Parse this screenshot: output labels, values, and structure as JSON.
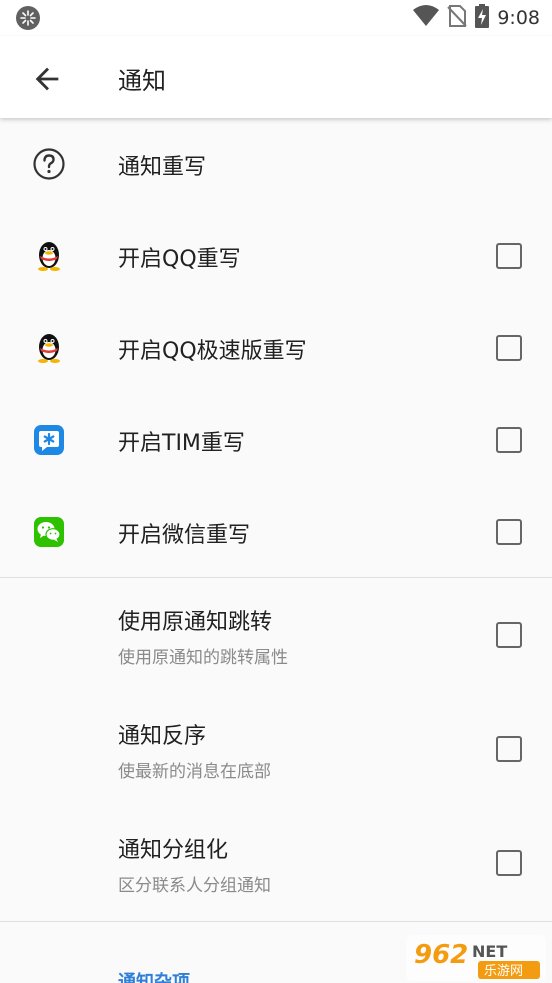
{
  "status_bar": {
    "time": "9:08",
    "icons": [
      "settings-notification-icon",
      "wifi-icon",
      "no-sim-icon",
      "battery-charging-icon"
    ]
  },
  "app_bar": {
    "back_icon": "arrow-back-icon",
    "title": "通知"
  },
  "items": [
    {
      "icon": "help-circle-icon",
      "label": "通知重写"
    },
    {
      "icon": "qq-penguin-icon",
      "label": "开启QQ重写",
      "checked": false
    },
    {
      "icon": "qq-penguin-icon",
      "label": "开启QQ极速版重写",
      "checked": false
    },
    {
      "icon": "tim-icon",
      "label": "开启TIM重写",
      "checked": false
    },
    {
      "icon": "wechat-icon",
      "label": "开启微信重写",
      "checked": false
    }
  ],
  "options": [
    {
      "label": "使用原通知跳转",
      "summary": "使用原通知的跳转属性",
      "checked": false
    },
    {
      "label": "通知反序",
      "summary": "使最新的消息在底部",
      "checked": false
    },
    {
      "label": "通知分组化",
      "summary": "区分联系人分组通知",
      "checked": false
    }
  ],
  "next_section": {
    "title": "通知杂项"
  },
  "watermark": {
    "brand": "962",
    "suffix": "NET",
    "caption": "乐游网"
  },
  "colors": {
    "accent": "#2f7fd8",
    "wechat": "#2dc100",
    "tim": "#1e88e5"
  }
}
